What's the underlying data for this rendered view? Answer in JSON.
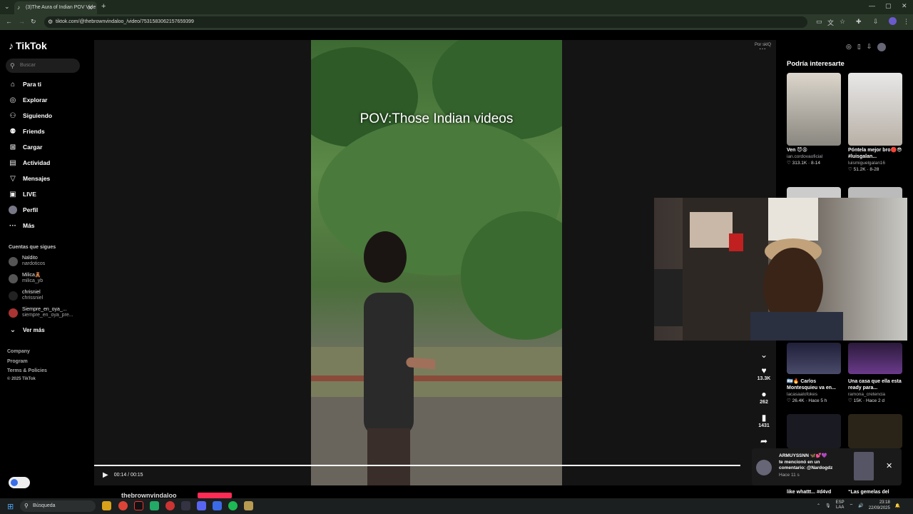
{
  "browser": {
    "tab_title": "(3)The Aura of Indian POV Vide",
    "url": "tiktok.com/@thebrownvindaloo_/video/7531583062157659399"
  },
  "sidebar": {
    "logo": "TikTok",
    "search_placeholder": "Buscar",
    "nav": [
      {
        "label": "Para ti",
        "icon": "home-icon"
      },
      {
        "label": "Explorar",
        "icon": "compass-icon"
      },
      {
        "label": "Siguiendo",
        "icon": "following-icon"
      },
      {
        "label": "Friends",
        "icon": "friends-icon"
      },
      {
        "label": "Cargar",
        "icon": "upload-icon"
      },
      {
        "label": "Actividad",
        "icon": "activity-icon"
      },
      {
        "label": "Mensajes",
        "icon": "messages-icon"
      },
      {
        "label": "LIVE",
        "icon": "live-icon"
      },
      {
        "label": "Perfil",
        "icon": "profile-avatar"
      },
      {
        "label": "Más",
        "icon": "more-icon"
      }
    ],
    "following_title": "Cuentas que sigues",
    "accounts": [
      {
        "name": "Naldito",
        "handle": "nardoticos"
      },
      {
        "name": "Milica🧸",
        "handle": "milica_yb"
      },
      {
        "name": "chrisniel",
        "handle": "chrissniel"
      },
      {
        "name": "Siempre_en_oya_...",
        "handle": "siempre_en_oya_pre..."
      }
    ],
    "see_more": "Ver más",
    "footer": [
      "Company",
      "Program",
      "Terms & Policies",
      "© 2025 TikTok"
    ]
  },
  "video": {
    "caption": "POV:Those Indian videos",
    "time": "00:14 / 00:15",
    "progress": 0.93,
    "username": "thebrownvindaloo",
    "reported_by": "Por sklQ",
    "likes": "13.3K",
    "comments": "262",
    "saves": "1431"
  },
  "right_panel": {
    "title": "Podría interesarte",
    "cards": [
      {
        "title": "Ven 😈😩",
        "author": "ian.cordovaoficial",
        "stats": "♡ 313.1K · 8-14"
      },
      {
        "title": "Póntela mejor bro🔴😎 #luisgalan...",
        "author": "luismiguelgalan16",
        "stats": "♡ 51.2K · 8-28"
      },
      {
        "title": "🇦🇷🔥 Carlos Montesquieu va en...",
        "author": "lacasaalofokes",
        "stats": "♡ 26.4K · Hace 5 h"
      },
      {
        "title": "Una casa que ella esta ready para...",
        "author": "ramona_cretencia",
        "stats": "♡ 15K · Hace 2 d"
      }
    ],
    "bottom_titles": [
      "like whattt... #d4vd",
      "“Las gemelas del"
    ]
  },
  "notification": {
    "line1": "ARMUYSSNN 🦋💕💜",
    "line2": "te mencionó en un",
    "line3": "comentario: @Nardogdz",
    "line4": "Hace 11 s"
  },
  "taskbar": {
    "search": "Búsqueda",
    "lang1": "ESP",
    "lang2": "LAA",
    "time": "23:18",
    "date": "22/09/2025"
  }
}
